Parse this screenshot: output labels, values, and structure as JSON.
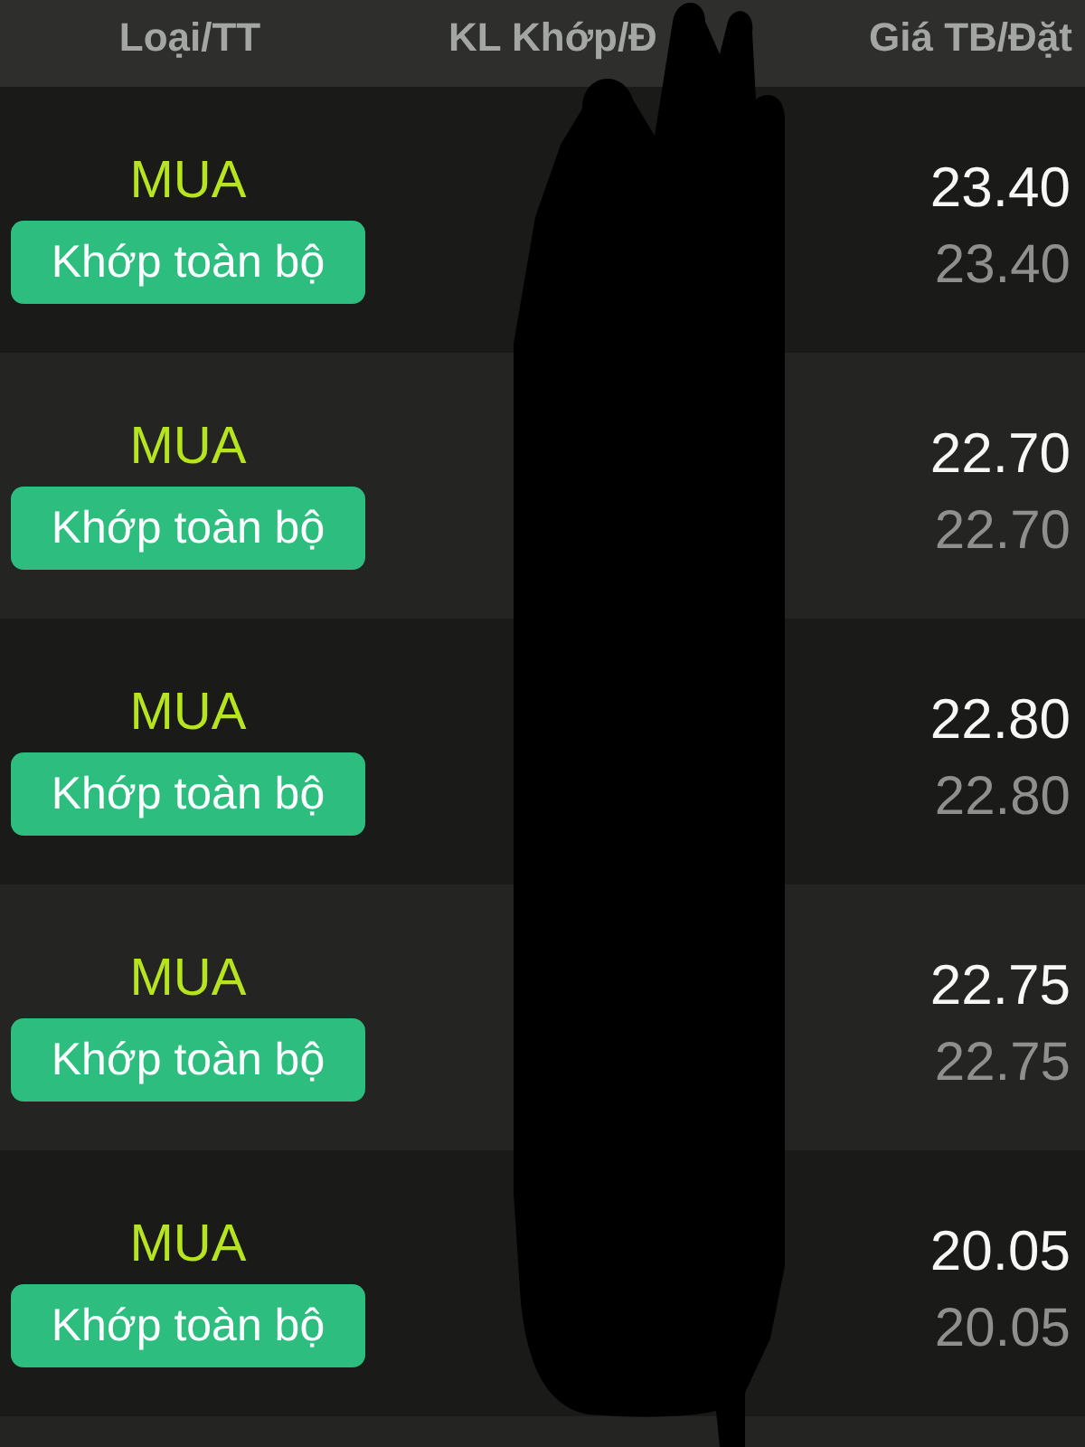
{
  "header": {
    "columns": [
      "Loại/TT",
      "KL Khớp/Đ",
      "Giá TB/Đặt"
    ]
  },
  "orders": [
    {
      "side": "MUA",
      "status": "Khớp toàn bộ",
      "avg_price": "23.40",
      "order_price": "23.40"
    },
    {
      "side": "MUA",
      "status": "Khớp toàn bộ",
      "avg_price": "22.70",
      "order_price": "22.70"
    },
    {
      "side": "MUA",
      "status": "Khớp toàn bộ",
      "avg_price": "22.80",
      "order_price": "22.80"
    },
    {
      "side": "MUA",
      "status": "Khớp toàn bộ",
      "avg_price": "22.75",
      "order_price": "22.75"
    },
    {
      "side": "MUA",
      "status": "Khớp toàn bộ",
      "avg_price": "20.05",
      "order_price": "20.05"
    }
  ]
}
